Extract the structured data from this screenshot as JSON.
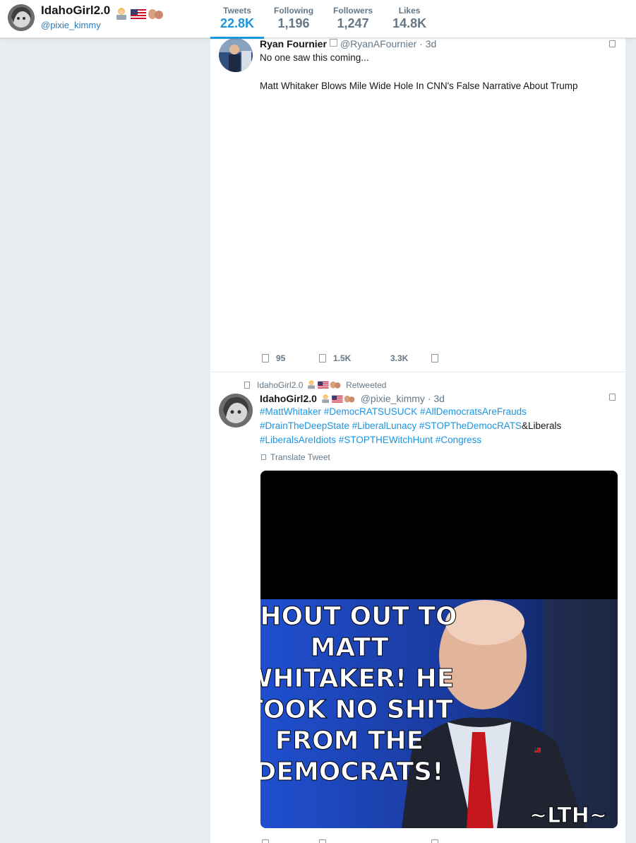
{
  "profile": {
    "name": "IdahoGirl2.0",
    "handle": "@pixie_kimmy",
    "stats": [
      {
        "label": "Tweets",
        "value": "22.8K",
        "active": true
      },
      {
        "label": "Following",
        "value": "1,196",
        "active": false
      },
      {
        "label": "Followers",
        "value": "1,247",
        "active": false
      },
      {
        "label": "Likes",
        "value": "14.8K",
        "active": false
      }
    ]
  },
  "tweets": [
    {
      "name": "Ryan Fournier",
      "handle": "@RyanAFournier",
      "time": "· 3d",
      "line1": "No one saw this coming...",
      "line2": "Matt Whitaker Blows Mile Wide Hole In CNN's False Narrative About Trump",
      "replies": "95",
      "retweets": "1.5K",
      "likes": "3.3K"
    },
    {
      "retweeted_by": "IdahoGirl2.0",
      "retweeted_label": "Retweeted",
      "name": "IdahoGirl2.0",
      "handle": "@pixie_kimmy",
      "time": "· 3d",
      "hashtags_line1": "#MattWhitaker  #DemocRATSUSUCK  #AllDemocratsAreFrauds",
      "hashtags_line2a": "#DrainTheDeepState #LiberalLunacy #STOPTheDemocRATS",
      "hashtags_line2b": "&Liberals",
      "hashtags_line3": "#LiberalsAreIdiots #STOPTHEWitchHunt #Congress",
      "translate": "Translate Tweet",
      "image": {
        "lines": [
          "SHOUT OUT TO",
          "MATT",
          "WHITAKER! HE",
          "TOOK NO SHIT",
          "FROM THE",
          "DEMOCRATS!"
        ],
        "signature": "~LTH~"
      }
    }
  ],
  "colors": {
    "accent": "#1b95e0",
    "background": "#e6ecf0",
    "muted": "#657786"
  }
}
